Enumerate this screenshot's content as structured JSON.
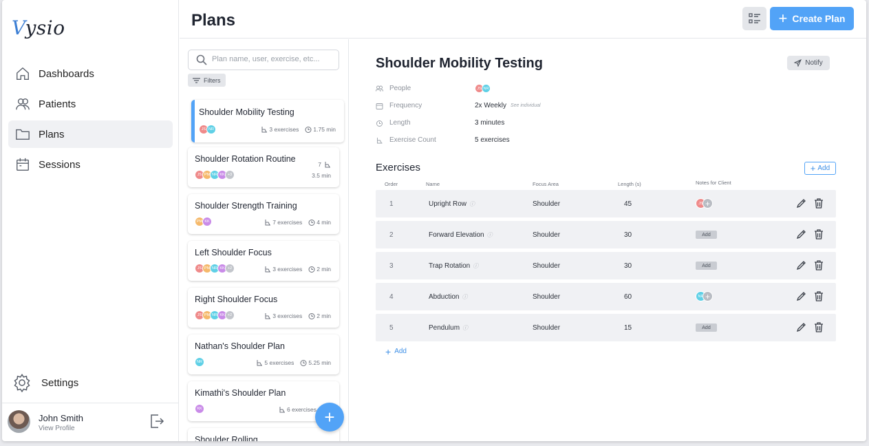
{
  "brand": {
    "logo_v": "V",
    "logo_rest": "ysio"
  },
  "sidebar": {
    "items": [
      {
        "label": "Dashboards",
        "icon": "home-icon",
        "active": false
      },
      {
        "label": "Patients",
        "icon": "users-icon",
        "active": false
      },
      {
        "label": "Plans",
        "icon": "folder-icon",
        "active": true
      },
      {
        "label": "Sessions",
        "icon": "calendar-icon",
        "active": false
      }
    ],
    "settings_label": "Settings",
    "user": {
      "name": "John Smith",
      "link": "View Profile"
    }
  },
  "header": {
    "title": "Plans",
    "create_label": "Create Plan"
  },
  "list": {
    "search_placeholder": "Plan name, user, exercise, etc...",
    "filters_label": "Filters",
    "plans": [
      {
        "title": "Shoulder Mobility Testing",
        "avatars": [
          "JS",
          "NR"
        ],
        "exercises": "3 exercises",
        "time": "1.75 min",
        "selected": true
      },
      {
        "title": "Shoulder Rotation Routine",
        "avatars": [
          "JS",
          "PM",
          "NR",
          "KK"
        ],
        "more": "+3",
        "count": "7",
        "time": "3.5 min"
      },
      {
        "title": "Shoulder Strength Training",
        "avatars": [
          "PM",
          "KK"
        ],
        "exercises": "7 exercises",
        "time": "4 min"
      },
      {
        "title": "Left Shoulder Focus",
        "avatars": [
          "JS",
          "PM",
          "NR",
          "KK"
        ],
        "more": "+2",
        "exercises": "3 exercises",
        "time": "2 min"
      },
      {
        "title": "Right Shoulder Focus",
        "avatars": [
          "JS",
          "PM",
          "NR",
          "KK"
        ],
        "more": "+2",
        "exercises": "3 exercises",
        "time": "2 min"
      },
      {
        "title": "Nathan's Shoulder Plan",
        "avatars": [
          "NR"
        ],
        "exercises": "5 exercises",
        "time": "5.25 min"
      },
      {
        "title": "Kimathi's Shoulder Plan",
        "avatars": [
          "KK"
        ],
        "exercises": "6 exercises",
        "time": ""
      },
      {
        "title": "Shoulder Rolling",
        "avatars": [],
        "exercises": "",
        "time": ""
      }
    ]
  },
  "detail": {
    "title": "Shoulder Mobility Testing",
    "notify_label": "Notify",
    "props": {
      "people_label": "People",
      "people": [
        "JS",
        "NR"
      ],
      "frequency_label": "Frequency",
      "frequency": "2x Weekly",
      "frequency_note": "See individual",
      "length_label": "Length",
      "length": "3 minutes",
      "count_label": "Exercise Count",
      "count": "5 exercises"
    },
    "exercises_heading": "Exercises",
    "add_label": "Add",
    "columns": {
      "order": "Order",
      "name": "Name",
      "focus": "Focus Area",
      "length": "Length (s)",
      "notes": "Notes for Client"
    },
    "rows": [
      {
        "order": "1",
        "name": "Upright Row",
        "focus": "Shoulder",
        "length": "45",
        "note_avatar": "JS"
      },
      {
        "order": "2",
        "name": "Forward Elevation",
        "focus": "Shoulder",
        "length": "30",
        "note_add": "Add"
      },
      {
        "order": "3",
        "name": "Trap Rotation",
        "focus": "Shoulder",
        "length": "30",
        "note_add": "Add"
      },
      {
        "order": "4",
        "name": "Abduction",
        "focus": "Shoulder",
        "length": "60",
        "note_avatar": "NR"
      },
      {
        "order": "5",
        "name": "Pendulum",
        "focus": "Shoulder",
        "length": "15",
        "note_add": "Add"
      }
    ],
    "add_row_label": "Add"
  },
  "colors": {
    "accent": "#52a3f7",
    "JS": "#ef8a8a",
    "PM": "#f5b96b",
    "NR": "#5fd0e6",
    "KK": "#c98be8",
    "more": "#c3c6cc"
  }
}
